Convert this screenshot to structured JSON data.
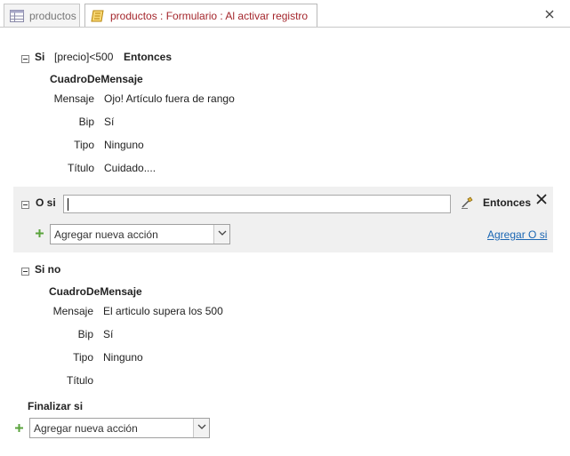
{
  "tabs": [
    {
      "label": "productos",
      "icon": "table-icon"
    },
    {
      "label": "productos : Formulario : Al activar registro",
      "icon": "macro-icon"
    }
  ],
  "if_block": {
    "keyword": "Si",
    "condition": "[precio]<500",
    "then": "Entonces",
    "action": "CuadroDeMensaje",
    "args": [
      {
        "label": "Mensaje",
        "value": "Ojo! Artículo fuera de rango"
      },
      {
        "label": "Bip",
        "value": "Sí"
      },
      {
        "label": "Tipo",
        "value": "Ninguno"
      },
      {
        "label": "Título",
        "value": "Cuidado...."
      }
    ]
  },
  "elseif_block": {
    "keyword": "O si",
    "condition_value": "",
    "then": "Entonces",
    "add_action": "Agregar nueva acción",
    "add_elseif_link": "Agregar O si"
  },
  "else_block": {
    "keyword": "Si no",
    "action": "CuadroDeMensaje",
    "args": [
      {
        "label": "Mensaje",
        "value": "El articulo supera los 500"
      },
      {
        "label": "Bip",
        "value": "Sí"
      },
      {
        "label": "Tipo",
        "value": "Ninguno"
      },
      {
        "label": "Título",
        "value": ""
      }
    ]
  },
  "end_if": "Finalizar si",
  "bottom_add_action": "Agregar nueva acción",
  "colors": {
    "active_tab_text": "#a4262c",
    "link": "#1a66b3",
    "alt_section_bg": "#f0f0f0"
  }
}
